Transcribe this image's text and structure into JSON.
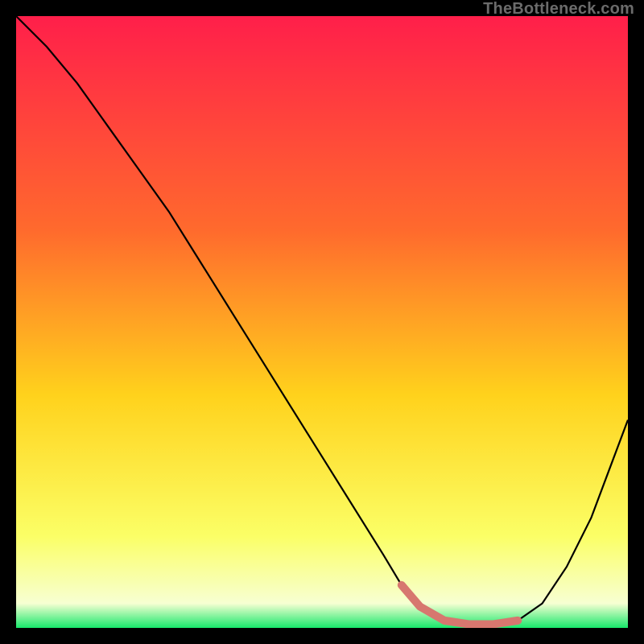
{
  "watermark": "TheBottleneck.com",
  "colors": {
    "bg_top": "#ff1f4a",
    "bg_mid1": "#ff6a2d",
    "bg_mid2": "#ffd21c",
    "bg_low": "#fbff66",
    "bg_pale": "#f7ffd2",
    "bg_bottom": "#17e86b",
    "curve": "#000000",
    "marker": "#d7776f"
  },
  "chart_data": {
    "type": "line",
    "title": "",
    "xlabel": "",
    "ylabel": "",
    "xlim": [
      0,
      100
    ],
    "ylim": [
      0,
      100
    ],
    "grid": false,
    "legend": false,
    "series": [
      {
        "name": "bottleneck-curve",
        "x": [
          0,
          5,
          10,
          15,
          20,
          25,
          30,
          35,
          40,
          45,
          50,
          55,
          60,
          63,
          66,
          70,
          74,
          78,
          82,
          86,
          90,
          94,
          100
        ],
        "values": [
          100,
          95,
          89,
          82,
          75,
          68,
          60,
          52,
          44,
          36,
          28,
          20,
          12,
          7,
          3.5,
          1.2,
          0.6,
          0.6,
          1.2,
          4,
          10,
          18,
          34
        ]
      }
    ],
    "annotations": [
      {
        "name": "optimal-range-marker",
        "type": "marker-segment",
        "x": [
          63,
          66,
          70,
          74,
          78,
          82
        ],
        "values": [
          7,
          3.5,
          1.2,
          0.6,
          0.6,
          1.2
        ]
      }
    ]
  }
}
